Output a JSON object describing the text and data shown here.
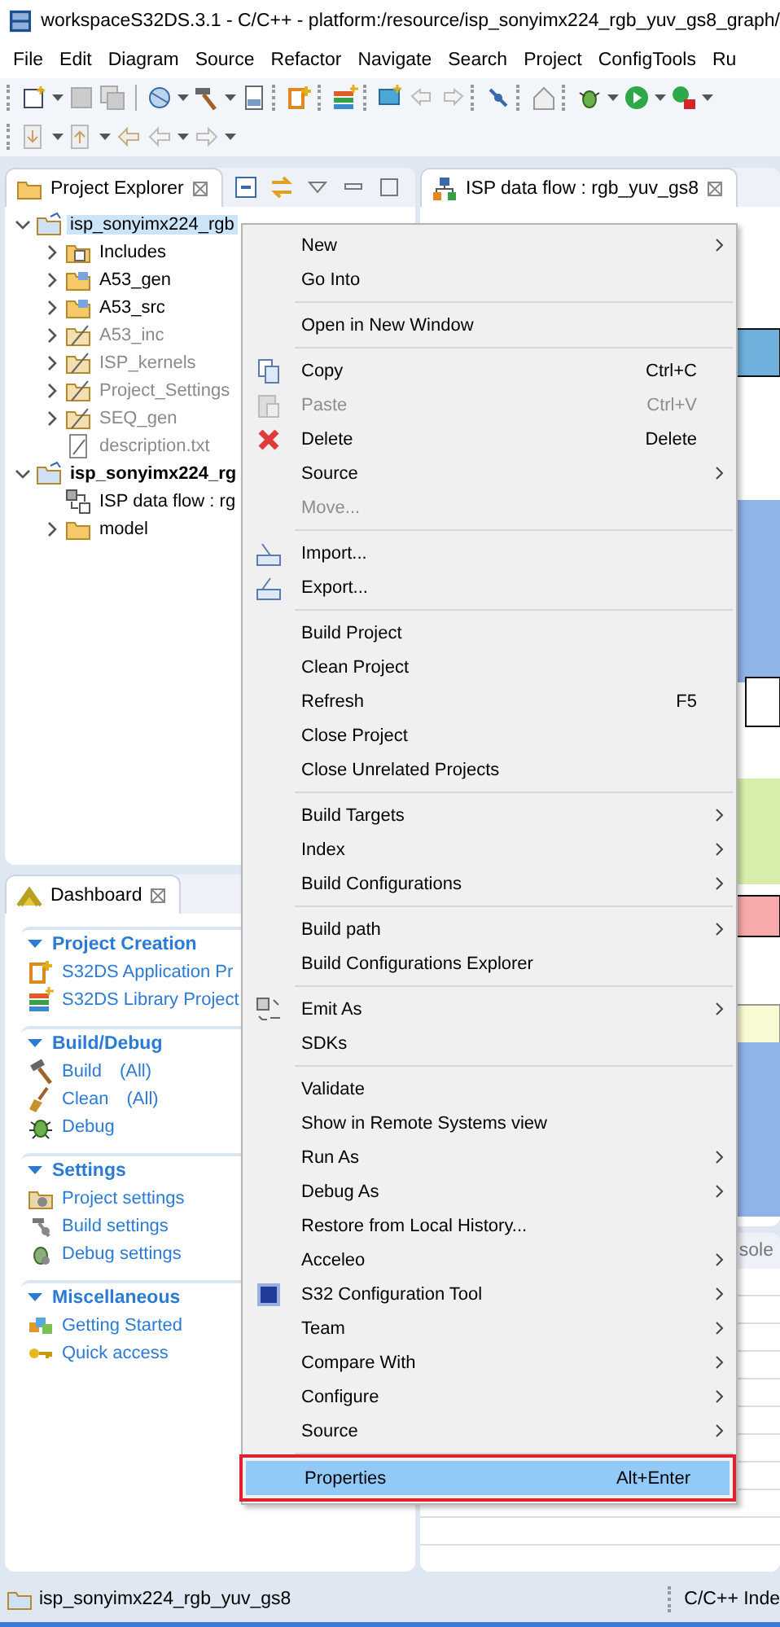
{
  "window": {
    "title": "workspaceS32DS.3.1 - C/C++ - platform:/resource/isp_sonyimx224_rgb_yuv_gs8_graph/"
  },
  "menu_bar": [
    "File",
    "Edit",
    "Diagram",
    "Source",
    "Refactor",
    "Navigate",
    "Search",
    "Project",
    "ConfigTools",
    "Ru"
  ],
  "project_explorer": {
    "title": "Project Explorer",
    "tree": [
      {
        "label": "isp_sonyimx224_rgb",
        "kind": "project",
        "expanded": true,
        "selected": true,
        "active": false,
        "dimmed": false,
        "children": [
          {
            "label": "Includes",
            "kind": "includes",
            "expanded": false,
            "selected": false,
            "active": false,
            "dimmed": false
          },
          {
            "label": "A53_gen",
            "kind": "source-folder",
            "expanded": false,
            "selected": false,
            "active": false,
            "dimmed": false
          },
          {
            "label": "A53_src",
            "kind": "source-folder",
            "expanded": false,
            "selected": false,
            "active": false,
            "dimmed": false
          },
          {
            "label": "A53_inc",
            "kind": "excluded-folder",
            "expanded": false,
            "selected": false,
            "active": false,
            "dimmed": true
          },
          {
            "label": "ISP_kernels",
            "kind": "excluded-folder",
            "expanded": false,
            "selected": false,
            "active": false,
            "dimmed": true
          },
          {
            "label": "Project_Settings",
            "kind": "excluded-folder",
            "expanded": false,
            "selected": false,
            "active": false,
            "dimmed": true
          },
          {
            "label": "SEQ_gen",
            "kind": "excluded-folder",
            "expanded": false,
            "selected": false,
            "active": false,
            "dimmed": true
          },
          {
            "label": "description.txt",
            "kind": "file",
            "selected": false,
            "active": false,
            "dimmed": true
          }
        ]
      },
      {
        "label": "isp_sonyimx224_rg",
        "kind": "project",
        "expanded": true,
        "selected": false,
        "active": true,
        "dimmed": false,
        "children": [
          {
            "label": "ISP data flow : rg",
            "kind": "diagram",
            "selected": false,
            "active": false,
            "dimmed": false
          },
          {
            "label": "model",
            "kind": "folder",
            "expanded": false,
            "selected": false,
            "active": false,
            "dimmed": false
          }
        ]
      }
    ]
  },
  "editor": {
    "tab": "ISP data flow : rgb_yuv_gs8"
  },
  "console": {
    "tab": "sole"
  },
  "dashboard": {
    "title": "Dashboard",
    "sections": [
      {
        "title": "Project Creation",
        "expanded": true,
        "items": [
          {
            "label": "S32DS Application Pr",
            "kind": "new-app"
          },
          {
            "label": "S32DS Library Project",
            "kind": "new-lib"
          }
        ]
      },
      {
        "title": "Build/Debug",
        "expanded": true,
        "items": [
          {
            "label": "Build",
            "suffix": "(All)",
            "kind": "build"
          },
          {
            "label": "Clean",
            "suffix": "(All)",
            "kind": "clean"
          },
          {
            "label": "Debug",
            "kind": "debug"
          }
        ]
      },
      {
        "title": "Settings",
        "expanded": true,
        "items": [
          {
            "label": "Project settings",
            "kind": "project-settings"
          },
          {
            "label": "Build settings",
            "kind": "build-settings"
          },
          {
            "label": "Debug settings",
            "kind": "debug-settings"
          }
        ]
      },
      {
        "title": "Miscellaneous",
        "expanded": true,
        "items": [
          {
            "label": "Getting Started",
            "kind": "start"
          },
          {
            "label": "Quick access",
            "kind": "key"
          }
        ]
      }
    ]
  },
  "context_menu": {
    "groups": [
      [
        {
          "label": "New",
          "submenu": true,
          "disabled": false,
          "selected": false
        },
        {
          "label": "Go Into",
          "submenu": false,
          "disabled": false,
          "selected": false
        }
      ],
      [
        {
          "label": "Open in New Window",
          "submenu": false,
          "disabled": false,
          "selected": false
        }
      ],
      [
        {
          "label": "Copy",
          "shortcut": "Ctrl+C",
          "submenu": false,
          "disabled": false,
          "selected": false
        },
        {
          "label": "Paste",
          "shortcut": "Ctrl+V",
          "submenu": false,
          "disabled": true,
          "selected": false
        },
        {
          "label": "Delete",
          "shortcut": "Delete",
          "submenu": false,
          "disabled": false,
          "selected": false
        },
        {
          "label": "Source",
          "submenu": true,
          "disabled": false,
          "selected": false
        },
        {
          "label": "Move...",
          "submenu": false,
          "disabled": true,
          "selected": false
        }
      ],
      [
        {
          "label": "Import...",
          "submenu": false,
          "disabled": false,
          "selected": false
        },
        {
          "label": "Export...",
          "submenu": false,
          "disabled": false,
          "selected": false
        }
      ],
      [
        {
          "label": "Build Project",
          "submenu": false,
          "disabled": false,
          "selected": false
        },
        {
          "label": "Clean Project",
          "submenu": false,
          "disabled": false,
          "selected": false
        },
        {
          "label": "Refresh",
          "shortcut": "F5",
          "submenu": false,
          "disabled": false,
          "selected": false
        },
        {
          "label": "Close Project",
          "submenu": false,
          "disabled": false,
          "selected": false
        },
        {
          "label": "Close Unrelated Projects",
          "submenu": false,
          "disabled": false,
          "selected": false
        }
      ],
      [
        {
          "label": "Build Targets",
          "submenu": true,
          "disabled": false,
          "selected": false
        },
        {
          "label": "Index",
          "submenu": true,
          "disabled": false,
          "selected": false
        },
        {
          "label": "Build Configurations",
          "submenu": true,
          "disabled": false,
          "selected": false
        }
      ],
      [
        {
          "label": "Build path",
          "submenu": true,
          "disabled": false,
          "selected": false
        },
        {
          "label": "Build Configurations Explorer",
          "submenu": false,
          "disabled": false,
          "selected": false
        }
      ],
      [
        {
          "label": "Emit As",
          "submenu": true,
          "disabled": false,
          "selected": false
        },
        {
          "label": "SDKs",
          "submenu": false,
          "disabled": false,
          "selected": false
        }
      ],
      [
        {
          "label": "Validate",
          "submenu": false,
          "disabled": false,
          "selected": false
        },
        {
          "label": "Show in Remote Systems view",
          "submenu": false,
          "disabled": false,
          "selected": false
        },
        {
          "label": "Run As",
          "submenu": true,
          "disabled": false,
          "selected": false
        },
        {
          "label": "Debug As",
          "submenu": true,
          "disabled": false,
          "selected": false
        },
        {
          "label": "Restore from Local History...",
          "submenu": false,
          "disabled": false,
          "selected": false
        },
        {
          "label": "Acceleo",
          "submenu": true,
          "disabled": false,
          "selected": false
        },
        {
          "label": "S32 Configuration Tool",
          "submenu": true,
          "disabled": false,
          "selected": false
        },
        {
          "label": "Team",
          "submenu": true,
          "disabled": false,
          "selected": false
        },
        {
          "label": "Compare With",
          "submenu": true,
          "disabled": false,
          "selected": false
        },
        {
          "label": "Configure",
          "submenu": true,
          "disabled": false,
          "selected": false
        },
        {
          "label": "Source",
          "submenu": true,
          "disabled": false,
          "selected": false
        }
      ],
      [
        {
          "label": "Properties",
          "shortcut": "Alt+Enter",
          "submenu": false,
          "disabled": false,
          "selected": true
        }
      ]
    ]
  },
  "status_bar": {
    "selection": "isp_sonyimx224_rgb_yuv_gs8",
    "indexer": "C/C++ Inde"
  }
}
